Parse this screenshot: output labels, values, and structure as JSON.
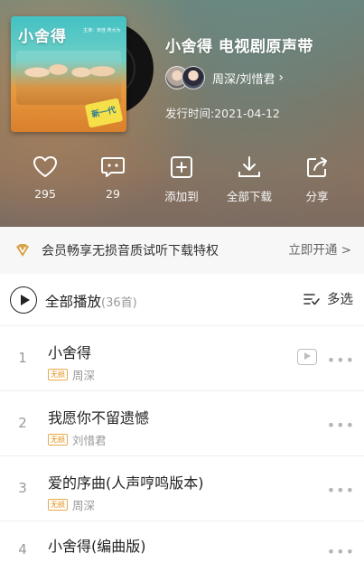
{
  "album": {
    "cover_title": "小舍得",
    "cover_subtitle": "主演：宋佳 佟大为",
    "cover_badge": "新一代",
    "title": "小舍得 电视剧原声带",
    "artists": "周深/刘惜君",
    "release_date": "发行时间:2021-04-12"
  },
  "actions": [
    {
      "icon": "heart-icon",
      "label": "295"
    },
    {
      "icon": "comment-icon",
      "label": "29"
    },
    {
      "icon": "add-icon",
      "label": "添加到"
    },
    {
      "icon": "download-icon",
      "label": "全部下载"
    },
    {
      "icon": "share-icon",
      "label": "分享"
    }
  ],
  "vip": {
    "icon": "vip-icon",
    "text": "会员畅享无损音质试听下载特权",
    "cta": "立即开通 >"
  },
  "play_all": {
    "label": "全部播放",
    "count": "(36首)",
    "multi_select": "多选"
  },
  "songs": [
    {
      "index": "1",
      "title": "小舍得",
      "badge": "无损",
      "singer": "周深",
      "has_mv": true
    },
    {
      "index": "2",
      "title": "我愿你不留遗憾",
      "badge": "无损",
      "singer": "刘惜君",
      "has_mv": false
    },
    {
      "index": "3",
      "title": "爱的序曲(人声哼鸣版本)",
      "badge": "无损",
      "singer": "周深",
      "has_mv": false
    },
    {
      "index": "4",
      "title": "小舍得(编曲版)",
      "badge": "",
      "singer": "",
      "has_mv": false
    }
  ],
  "colors": {
    "vip_gold": "#d8a24a",
    "lossless_badge": "#e08e16"
  }
}
